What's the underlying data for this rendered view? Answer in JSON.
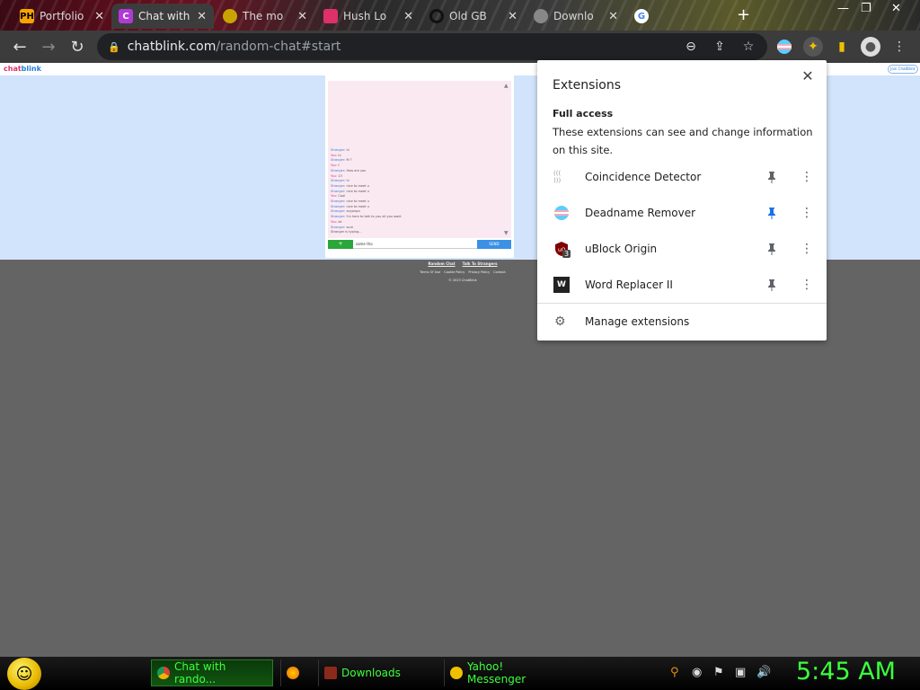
{
  "browser": {
    "tabs": [
      {
        "label": "Portfolio",
        "favicon": "PH",
        "favicon_color": "#f7a400"
      },
      {
        "label": "Chat with",
        "favicon": "C",
        "favicon_color": "#b03ad6",
        "active": true
      },
      {
        "label": "The mo",
        "favicon": "",
        "favicon_color": "#c9a400"
      },
      {
        "label": "Hush Lo",
        "favicon": "",
        "favicon_color": "#e0306a"
      },
      {
        "label": "Old GB",
        "favicon": "",
        "favicon_color": "#222"
      },
      {
        "label": "Downlo",
        "favicon": "",
        "favicon_color": "#888"
      },
      {
        "label": "",
        "favicon": "G",
        "favicon_color": "#4285f4"
      }
    ],
    "url_host": "chatblink.com",
    "url_path": "/random-chat#start"
  },
  "site": {
    "logo_a": "chat",
    "logo_b": "blink",
    "top_button": "Join ChatBlink",
    "chat_lines": [
      {
        "who": "Stranger:",
        "text": "hi",
        "s": false
      },
      {
        "who": "You:",
        "text": "hi",
        "s": true
      },
      {
        "who": "Stranger:",
        "text": "M ?",
        "s": false
      },
      {
        "who": "You:",
        "text": "f",
        "s": true
      },
      {
        "who": "Stranger:",
        "text": "How are you",
        "s": false
      },
      {
        "who": "You:",
        "text": "13",
        "s": true
      },
      {
        "who": "Stranger:",
        "text": "hi",
        "s": false
      },
      {
        "who": "Stranger:",
        "text": "nice to meet u",
        "s": false
      },
      {
        "who": "Stranger:",
        "text": "nice to meet u",
        "s": false
      },
      {
        "who": "You:",
        "text": "Cool",
        "s": true
      },
      {
        "who": "Stranger:",
        "text": "nice to meet u",
        "s": false
      },
      {
        "who": "Stranger:",
        "text": "nice to meet u",
        "s": false
      },
      {
        "who": "Stranger:",
        "text": "anyways",
        "s": false
      },
      {
        "who": "Stranger:",
        "text": "i'm here to talk to you all you want",
        "s": false
      },
      {
        "who": "You:",
        "text": "ok",
        "s": true
      },
      {
        "who": "Stranger:",
        "text": "sure",
        "s": false
      },
      {
        "who": "",
        "text": "Stranger is typing...",
        "s": true
      }
    ],
    "plus_label": "+",
    "input_value": "same tho",
    "send_label": "SEND",
    "footer_links": [
      "Random Chat",
      "Talk To Strangers"
    ],
    "footer_small": [
      "Terms Of Use",
      "Cookie Policy",
      "Privacy Policy",
      "Contact"
    ],
    "copyright": "© 2023 ChatBlink"
  },
  "extensions": {
    "title": "Extensions",
    "section_title": "Full access",
    "section_desc": "These extensions can see and change information on this site.",
    "items": [
      {
        "name": "Coincidence Detector",
        "pinned": false,
        "icon": "coincidence-detector-icon"
      },
      {
        "name": "Deadname Remover",
        "pinned": true,
        "icon": "trans-flag-icon"
      },
      {
        "name": "uBlock Origin",
        "pinned": false,
        "icon": "ublock-shield-icon",
        "badge": "3"
      },
      {
        "name": "Word Replacer II",
        "pinned": false,
        "icon": "word-replacer-icon"
      }
    ],
    "manage_label": "Manage extensions"
  },
  "taskbar": {
    "tasks": [
      {
        "label": "Chat with rando...",
        "icon_color": "#e8a80c",
        "active": true
      },
      {
        "label": "",
        "icon_color": "#e8660c"
      },
      {
        "label": "Downloads",
        "icon_color": "#8b2a1a"
      },
      {
        "label": "Yahoo! Messenger",
        "icon_color": "#f0c000"
      }
    ],
    "clock": "5:45 AM"
  },
  "colors": {
    "pinned_blue": "#1a73e8",
    "taskbar_green": "#3dff3d"
  }
}
